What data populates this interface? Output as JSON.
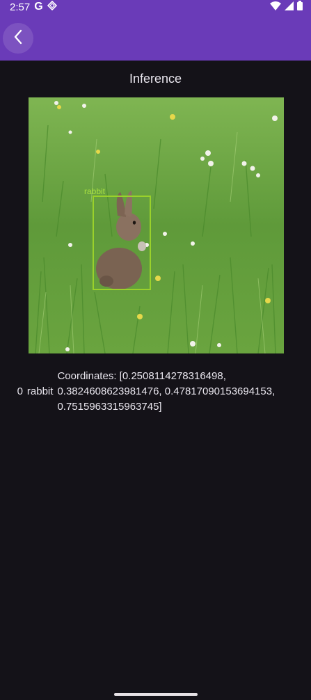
{
  "status_bar": {
    "time": "2:57",
    "left_icons": [
      "google-icon",
      "diamond-app-icon"
    ],
    "right_icons": [
      "wifi-icon",
      "signal-icon",
      "battery-icon"
    ]
  },
  "app_bar": {
    "back_icon": "chevron-left-icon",
    "background_color": "#6a3bb8"
  },
  "page": {
    "title": "Inference"
  },
  "detection_image": {
    "box_label": "rabbit",
    "box_color": "#9ad12b"
  },
  "results": [
    {
      "index": "0",
      "class_name": "rabbit",
      "coordinates_text": "Coordinates: [0.2508114278316498, 0.3824608623981476, 0.47817090153694153, 0.7515963315963745]"
    }
  ]
}
